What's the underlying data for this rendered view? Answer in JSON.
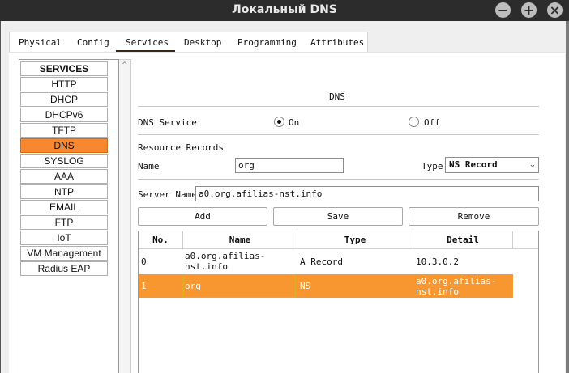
{
  "window": {
    "title": "Локальный DNS",
    "controls": {
      "minimize": "−",
      "maximize": "+",
      "close": "×"
    }
  },
  "tabs": [
    {
      "label": "Physical"
    },
    {
      "label": "Config"
    },
    {
      "label": "Services",
      "active": true
    },
    {
      "label": "Desktop"
    },
    {
      "label": "Programming"
    },
    {
      "label": "Attributes"
    }
  ],
  "sidebar": {
    "header": "SERVICES",
    "items": [
      {
        "label": "HTTP"
      },
      {
        "label": "DHCP"
      },
      {
        "label": "DHCPv6"
      },
      {
        "label": "TFTP"
      },
      {
        "label": "DNS",
        "active": true
      },
      {
        "label": "SYSLOG"
      },
      {
        "label": "AAA"
      },
      {
        "label": "NTP"
      },
      {
        "label": "EMAIL"
      },
      {
        "label": "FTP"
      },
      {
        "label": "IoT"
      },
      {
        "label": "VM Management"
      },
      {
        "label": "Radius EAP"
      }
    ],
    "scroll_arrow": "^"
  },
  "dns": {
    "title": "DNS",
    "service_label": "DNS Service",
    "on_label": "On",
    "off_label": "Off",
    "service_state": "On",
    "resource_records_label": "Resource Records",
    "name_label": "Name",
    "name_value": "org",
    "type_label": "Type",
    "type_value": "NS Record",
    "server_name_label": "Server Name",
    "server_name_value": "a0.org.afilias-nst.info",
    "add_label": "Add",
    "save_label": "Save",
    "remove_label": "Remove"
  },
  "table": {
    "columns": [
      "No.",
      "Name",
      "Type",
      "Detail"
    ],
    "rows": [
      {
        "no": "0",
        "name_line1": "a0.org.afilias-",
        "name_line2": "nst.info",
        "type": "A Record",
        "detail_line1": "10.3.0.2",
        "detail_line2": ""
      },
      {
        "no": "1",
        "name_line1": "org",
        "name_line2": "",
        "type": "NS",
        "detail_line1": "a0.org.afilias-",
        "detail_line2": "nst.info",
        "selected": true
      }
    ]
  },
  "colors": {
    "accent": "#f7882f",
    "selected_row": "#f8962f",
    "titlebar": "#2c2c2c"
  }
}
